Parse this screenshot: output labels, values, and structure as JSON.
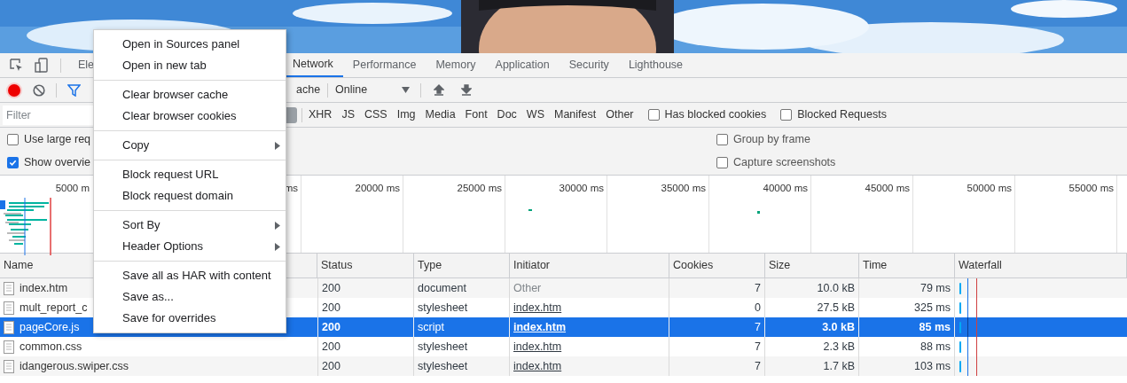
{
  "panel_tabs": [
    {
      "label": "Ele",
      "selected": false
    },
    {
      "label": "Network",
      "selected": true
    },
    {
      "label": "Performance",
      "selected": false
    },
    {
      "label": "Memory",
      "selected": false
    },
    {
      "label": "Application",
      "selected": false
    },
    {
      "label": "Security",
      "selected": false
    },
    {
      "label": "Lighthouse",
      "selected": false
    }
  ],
  "toolbar": {
    "recording": true,
    "filter_active": true,
    "cache_label": "ache",
    "throttle": "Online"
  },
  "filter": {
    "placeholder": "Filter",
    "types": [
      "XHR",
      "JS",
      "CSS",
      "Img",
      "Media",
      "Font",
      "Doc",
      "WS",
      "Manifest",
      "Other"
    ],
    "options": [
      {
        "label": "Has blocked cookies",
        "checked": false
      },
      {
        "label": "Blocked Requests",
        "checked": false
      }
    ]
  },
  "settings_left": [
    {
      "label": "Use large req",
      "checked": false
    },
    {
      "label": "Show overvie",
      "checked": true
    }
  ],
  "settings_right": [
    {
      "label": "Group by frame",
      "checked": false
    },
    {
      "label": "Capture screenshots",
      "checked": false
    }
  ],
  "overview": {
    "ticks": [
      "5000 m",
      "ms",
      "20000 ms",
      "25000 ms",
      "30000 ms",
      "35000 ms",
      "40000 ms",
      "45000 ms",
      "50000 ms",
      "55000 ms"
    ]
  },
  "table": {
    "columns": [
      "Name",
      "Status",
      "Type",
      "Initiator",
      "Cookies",
      "Size",
      "Time",
      "Waterfall"
    ],
    "rows": [
      {
        "name": "index.htm",
        "status": "200",
        "type": "document",
        "initiator": "Other",
        "initiator_link": false,
        "cookies": "7",
        "size": "10.0 kB",
        "time": "79 ms",
        "selected": false
      },
      {
        "name": "mult_report_c",
        "status": "200",
        "type": "stylesheet",
        "initiator": "index.htm",
        "initiator_link": true,
        "cookies": "0",
        "size": "27.5 kB",
        "time": "325 ms",
        "selected": false
      },
      {
        "name": "pageCore.js",
        "status": "200",
        "type": "script",
        "initiator": "index.htm",
        "initiator_link": true,
        "cookies": "7",
        "size": "3.0 kB",
        "time": "85 ms",
        "selected": true
      },
      {
        "name": "common.css",
        "status": "200",
        "type": "stylesheet",
        "initiator": "index.htm",
        "initiator_link": true,
        "cookies": "7",
        "size": "2.3 kB",
        "time": "88 ms",
        "selected": false
      },
      {
        "name": "idangerous.swiper.css",
        "status": "200",
        "type": "stylesheet",
        "initiator": "index.htm",
        "initiator_link": true,
        "cookies": "7",
        "size": "1.7 kB",
        "time": "103 ms",
        "selected": false
      }
    ]
  },
  "context_menu": {
    "groups": [
      [
        {
          "label": "Open in Sources panel",
          "submenu": false
        },
        {
          "label": "Open in new tab",
          "submenu": false
        }
      ],
      [
        {
          "label": "Clear browser cache",
          "submenu": false
        },
        {
          "label": "Clear browser cookies",
          "submenu": false
        }
      ],
      [
        {
          "label": "Copy",
          "submenu": true
        }
      ],
      [
        {
          "label": "Block request URL",
          "submenu": false
        },
        {
          "label": "Block request domain",
          "submenu": false
        }
      ],
      [
        {
          "label": "Sort By",
          "submenu": true
        },
        {
          "label": "Header Options",
          "submenu": true
        }
      ],
      [
        {
          "label": "Save all as HAR with content",
          "submenu": false
        },
        {
          "label": "Save as...",
          "submenu": false
        },
        {
          "label": "Save for overrides",
          "submenu": false
        }
      ]
    ]
  }
}
